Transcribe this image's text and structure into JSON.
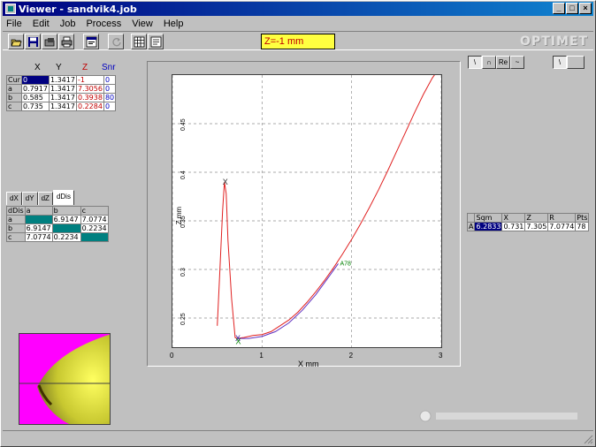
{
  "window": {
    "title": "Viewer - sandvik4.job",
    "min_label": "_",
    "max_label": "□",
    "close_label": "×"
  },
  "menu": [
    "File",
    "Edit",
    "Job",
    "Process",
    "View",
    "Help"
  ],
  "toolbar": {
    "z_field": "Z=-1 mm",
    "brand": "OPTIMET",
    "icons": [
      "open-icon",
      "save-icon",
      "save-as-icon",
      "print-icon",
      "properties-icon",
      "refresh-icon",
      "grid-icon",
      "export-icon"
    ]
  },
  "right_tools": {
    "group1": [
      "\\",
      "∩",
      "Re",
      "~"
    ],
    "group2": [
      "\\",
      ""
    ]
  },
  "points_table": {
    "headers": [
      "X",
      "Y",
      "Z",
      "Snr"
    ],
    "rows": [
      {
        "label": "Cur",
        "x": "0",
        "y": "1.3417",
        "z": "-1",
        "snr": "0"
      },
      {
        "label": "a",
        "x": "0.7917",
        "y": "1.3417",
        "z": "7.3056",
        "snr": "0"
      },
      {
        "label": "b",
        "x": "0.585",
        "y": "1.3417",
        "z": "0.3938",
        "snr": "80"
      },
      {
        "label": "c",
        "x": "0.735",
        "y": "1.3417",
        "z": "0.2284",
        "snr": "0"
      }
    ]
  },
  "dist_tabs": [
    "dX",
    "dY",
    "dZ",
    "dDis"
  ],
  "dist_table": {
    "corner": "dDis",
    "cols": [
      "a",
      "b",
      "c"
    ],
    "rows": [
      {
        "label": "a",
        "cells": [
          "",
          "6.9147",
          "7.0774"
        ]
      },
      {
        "label": "b",
        "cells": [
          "6.9147",
          "",
          "0.2234"
        ]
      },
      {
        "label": "c",
        "cells": [
          "7.0774",
          "0.2234",
          ""
        ]
      }
    ]
  },
  "fit_table": {
    "headers": [
      "",
      "Sqm",
      "X",
      "Z",
      "R",
      "Pts"
    ],
    "row": [
      "A",
      "6.2833",
      "0.731",
      "7.305",
      "7.0774",
      "78"
    ]
  },
  "chart_data": {
    "type": "line",
    "xlabel": "X mm",
    "ylabel": "Z mm",
    "xlim": [
      0,
      3
    ],
    "ylim": [
      0.22,
      0.5
    ],
    "xticks": [
      "0",
      "1",
      "2",
      "3"
    ],
    "yticks": [
      "0.25",
      "0.3",
      "0.35",
      "0.4",
      "0.45"
    ],
    "grid": true,
    "series": [
      {
        "color": "#e02020",
        "points": [
          [
            0.5,
            0.242
          ],
          [
            0.53,
            0.3
          ],
          [
            0.56,
            0.36
          ],
          [
            0.58,
            0.39
          ],
          [
            0.6,
            0.378
          ],
          [
            0.62,
            0.33
          ],
          [
            0.66,
            0.27
          ],
          [
            0.7,
            0.23
          ],
          [
            0.72,
            0.229
          ],
          [
            0.8,
            0.23
          ],
          [
            0.9,
            0.232
          ],
          [
            1.0,
            0.233
          ],
          [
            1.1,
            0.236
          ],
          [
            1.2,
            0.242
          ],
          [
            1.3,
            0.248
          ],
          [
            1.4,
            0.256
          ],
          [
            1.5,
            0.266
          ],
          [
            1.6,
            0.277
          ],
          [
            1.7,
            0.289
          ],
          [
            1.8,
            0.302
          ],
          [
            1.9,
            0.316
          ],
          [
            2.0,
            0.331
          ],
          [
            2.1,
            0.347
          ],
          [
            2.2,
            0.364
          ],
          [
            2.3,
            0.382
          ],
          [
            2.4,
            0.401
          ],
          [
            2.5,
            0.421
          ],
          [
            2.6,
            0.441
          ],
          [
            2.7,
            0.461
          ],
          [
            2.8,
            0.48
          ],
          [
            2.9,
            0.497
          ],
          [
            3.0,
            0.51
          ]
        ]
      },
      {
        "color": "#6030c0",
        "points": [
          [
            0.72,
            0.229
          ],
          [
            0.85,
            0.229
          ],
          [
            1.0,
            0.231
          ],
          [
            1.15,
            0.236
          ],
          [
            1.3,
            0.245
          ],
          [
            1.45,
            0.258
          ],
          [
            1.6,
            0.274
          ],
          [
            1.75,
            0.293
          ],
          [
            1.85,
            0.306
          ]
        ]
      }
    ],
    "markers": [
      {
        "label": "X",
        "x": 0.59,
        "y": 0.39,
        "color": "#303030"
      },
      {
        "label": "X",
        "x": 0.73,
        "y": 0.229,
        "color": "#4020a0"
      },
      {
        "label": "X",
        "x": 0.735,
        "y": 0.226,
        "color": "#008000"
      }
    ],
    "annotations": [
      {
        "text": "A78",
        "x": 1.85,
        "y": 0.306,
        "color": "#008000"
      }
    ]
  }
}
